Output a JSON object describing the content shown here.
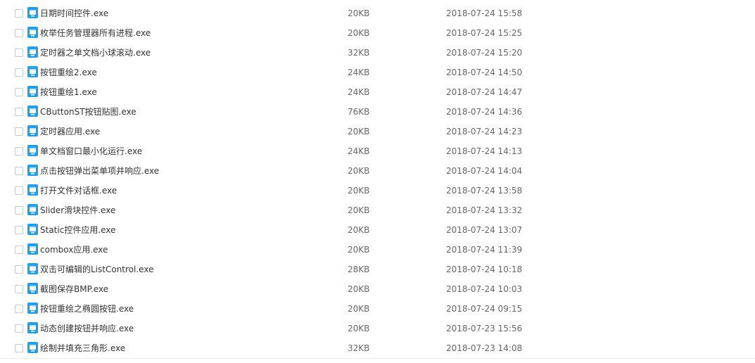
{
  "accent_color": "#1ea0f0",
  "files": [
    {
      "name": "日期时间控件.exe",
      "size": "20KB",
      "date": "2018-07-24 15:58"
    },
    {
      "name": "枚举任务管理器所有进程.exe",
      "size": "20KB",
      "date": "2018-07-24 15:25"
    },
    {
      "name": "定时器之单文档小球滚动.exe",
      "size": "32KB",
      "date": "2018-07-24 15:20"
    },
    {
      "name": "按钮重绘2.exe",
      "size": "24KB",
      "date": "2018-07-24 14:50"
    },
    {
      "name": "按钮重绘1.exe",
      "size": "24KB",
      "date": "2018-07-24 14:47"
    },
    {
      "name": "CButtonST按钮贴图.exe",
      "size": "76KB",
      "date": "2018-07-24 14:36"
    },
    {
      "name": "定时器应用.exe",
      "size": "20KB",
      "date": "2018-07-24 14:23"
    },
    {
      "name": "单文档窗口最小化运行.exe",
      "size": "24KB",
      "date": "2018-07-24 14:13"
    },
    {
      "name": "点击按钮弹出菜单项并响应.exe",
      "size": "20KB",
      "date": "2018-07-24 14:04"
    },
    {
      "name": "打开文件对话框.exe",
      "size": "20KB",
      "date": "2018-07-24 13:58"
    },
    {
      "name": "Slider滑块控件.exe",
      "size": "20KB",
      "date": "2018-07-24 13:32"
    },
    {
      "name": "Static控件应用.exe",
      "size": "20KB",
      "date": "2018-07-24 13:07"
    },
    {
      "name": "combox应用.exe",
      "size": "20KB",
      "date": "2018-07-24 11:39"
    },
    {
      "name": "双击可编辑的ListControl.exe",
      "size": "28KB",
      "date": "2018-07-24 10:18"
    },
    {
      "name": "截图保存BMP.exe",
      "size": "20KB",
      "date": "2018-07-24 10:03"
    },
    {
      "name": "按钮重绘之椭圆按钮.exe",
      "size": "20KB",
      "date": "2018-07-24 09:15"
    },
    {
      "name": "动态创建按钮并响应.exe",
      "size": "20KB",
      "date": "2018-07-23 15:56"
    },
    {
      "name": "绘制并填充三角形.exe",
      "size": "32KB",
      "date": "2018-07-23 14:08"
    }
  ]
}
